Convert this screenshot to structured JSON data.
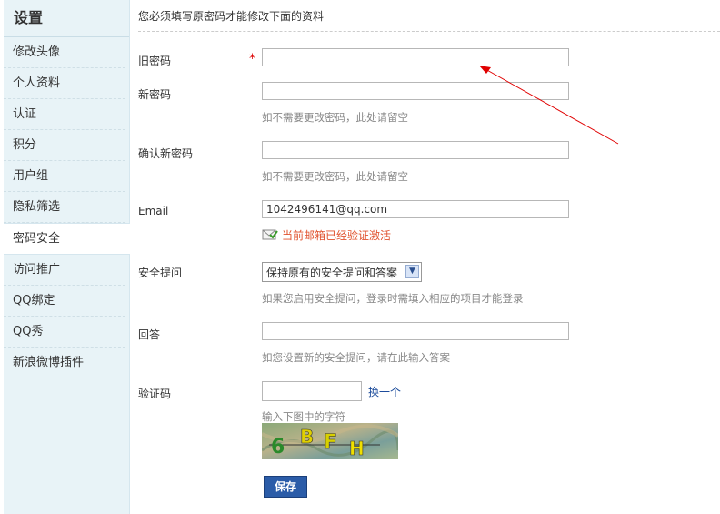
{
  "sidebar": {
    "title": "设置",
    "items": [
      {
        "label": "修改头像"
      },
      {
        "label": "个人资料"
      },
      {
        "label": "认证"
      },
      {
        "label": "积分"
      },
      {
        "label": "用户组"
      },
      {
        "label": "隐私筛选"
      },
      {
        "label": "密码安全"
      },
      {
        "label": "访问推广"
      },
      {
        "label": "QQ绑定"
      },
      {
        "label": "QQ秀"
      },
      {
        "label": "新浪微博插件"
      }
    ],
    "active_index": 6
  },
  "form": {
    "notice": "您必须填写原密码才能修改下面的资料",
    "old_password": {
      "label": "旧密码",
      "required_mark": "*",
      "value": ""
    },
    "new_password": {
      "label": "新密码",
      "value": "",
      "hint": "如不需要更改密码，此处请留空"
    },
    "confirm_password": {
      "label": "确认新密码",
      "value": "",
      "hint": "如不需要更改密码，此处请留空"
    },
    "email": {
      "label": "Email",
      "value": "1042496141@qq.com",
      "status": "当前邮箱已经验证激活",
      "status_icon": "envelope-check-icon"
    },
    "security_question": {
      "label": "安全提问",
      "selected": "保持原有的安全提问和答案",
      "hint": "如果您启用安全提问，登录时需填入相应的项目才能登录"
    },
    "answer": {
      "label": "回答",
      "value": "",
      "hint": "如您设置新的安全提问，请在此输入答案"
    },
    "captcha": {
      "label": "验证码",
      "value": "",
      "change_link": "换一个",
      "hint": "输入下图中的字符",
      "image_text": "6BFH"
    },
    "save_label": "保存"
  }
}
